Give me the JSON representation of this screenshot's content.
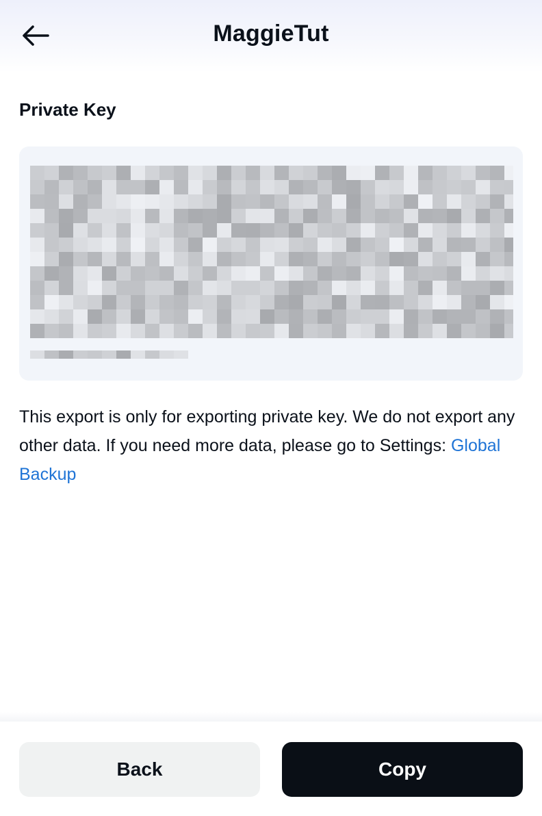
{
  "header": {
    "title": "MaggieTut",
    "back_icon": "arrow-left-icon"
  },
  "private_key": {
    "label": "Private Key",
    "state": "blurred"
  },
  "notice": {
    "text": "This export is only for exporting private key. We do not export any other data. If you need more data, please go to Settings: ",
    "link_text": "Global Backup"
  },
  "footer": {
    "back_label": "Back",
    "copy_label": "Copy"
  },
  "colors": {
    "link": "#1f74d6",
    "primary_button": "#0a0f16",
    "secondary_button": "#f0f2f2",
    "key_background": "#f2f5fa"
  }
}
